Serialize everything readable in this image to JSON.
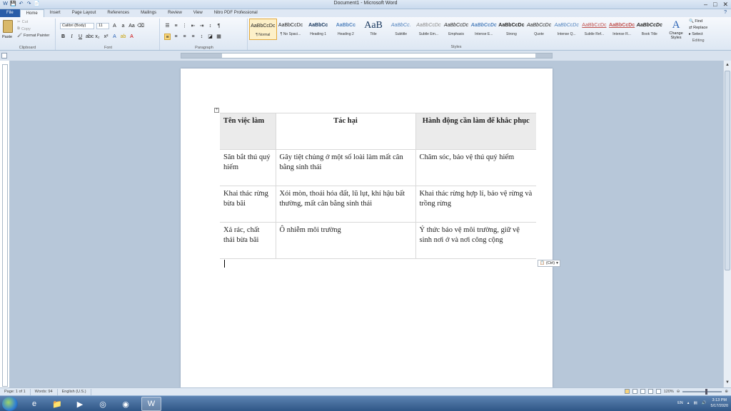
{
  "window": {
    "title": "Document1 - Microsoft Word",
    "qat": [
      "W",
      "💾",
      "↶",
      "↷",
      "📄"
    ],
    "controls": [
      "–",
      "□",
      "✕"
    ]
  },
  "tabs": [
    "File",
    "Home",
    "Insert",
    "Page Layout",
    "References",
    "Mailings",
    "Review",
    "View",
    "Nitro PDF Professional"
  ],
  "ribbon": {
    "clipboard": {
      "paste": "Paste",
      "cut": "Cut",
      "copy": "Copy",
      "format_painter": "Format Painter",
      "label": "Clipboard"
    },
    "font": {
      "name": "Calibri (Body)",
      "size": "11",
      "label": "Font"
    },
    "paragraph": {
      "label": "Paragraph"
    },
    "styles": {
      "label": "Styles",
      "items": [
        {
          "preview": "AaBbCcDc",
          "name": "¶ Normal"
        },
        {
          "preview": "AaBbCcDc",
          "name": "¶ No Spaci..."
        },
        {
          "preview": "AaBbCc",
          "name": "Heading 1"
        },
        {
          "preview": "AaBbCc",
          "name": "Heading 2"
        },
        {
          "preview": "AaB",
          "name": "Title"
        },
        {
          "preview": "AaBbCc.",
          "name": "Subtitle"
        },
        {
          "preview": "AaBbCcDc",
          "name": "Subtle Em..."
        },
        {
          "preview": "AaBbCcDc",
          "name": "Emphasis"
        },
        {
          "preview": "AaBbCcDc",
          "name": "Intense E..."
        },
        {
          "preview": "AaBbCcDc",
          "name": "Strong"
        },
        {
          "preview": "AaBbCcDc",
          "name": "Quote"
        },
        {
          "preview": "AaBbCcDc",
          "name": "Intense Q..."
        },
        {
          "preview": "AaBbCcDc",
          "name": "Subtle Ref..."
        },
        {
          "preview": "AaBbCcDc",
          "name": "Intense R..."
        },
        {
          "preview": "AaBbCcDc",
          "name": "Book Title"
        }
      ]
    },
    "change_styles": "Change Styles",
    "editing": {
      "find": "Find",
      "replace": "Replace",
      "select": "Select",
      "label": "Editing"
    }
  },
  "table": {
    "headers": [
      "Tên việc làm",
      "Tác hại",
      "Hành động cần làm để khắc phục"
    ],
    "rows": [
      [
        "Săn bắt thú quý hiếm",
        "Gây tiệt chủng ở một số loài làm mất cân bằng sinh thái",
        "Chăm sóc, bảo vệ thú quý hiếm"
      ],
      [
        "Khai thác rừng bừa bãi",
        "Xói mòn, thoái hóa đất, lũ lụt, khí hậu bất thường, mất cân bằng sinh thái",
        "Khai thác rừng hợp lí, bảo vệ rừng và trồng rừng"
      ],
      [
        "Xả rác, chất thải bừa bãi",
        "Ô nhiễm môi trường",
        "Ý thức bảo vệ môi trường, giữ vệ sinh nơi ở và nơi công cộng"
      ]
    ]
  },
  "paste_options": "(Ctrl)",
  "status": {
    "page": "Page: 1 of 1",
    "words": "Words: 94",
    "language": "English (U.S.)",
    "zoom": "120%"
  },
  "tray": {
    "lang": "EN",
    "time": "3:13 PM",
    "date": "5/17/2020"
  }
}
